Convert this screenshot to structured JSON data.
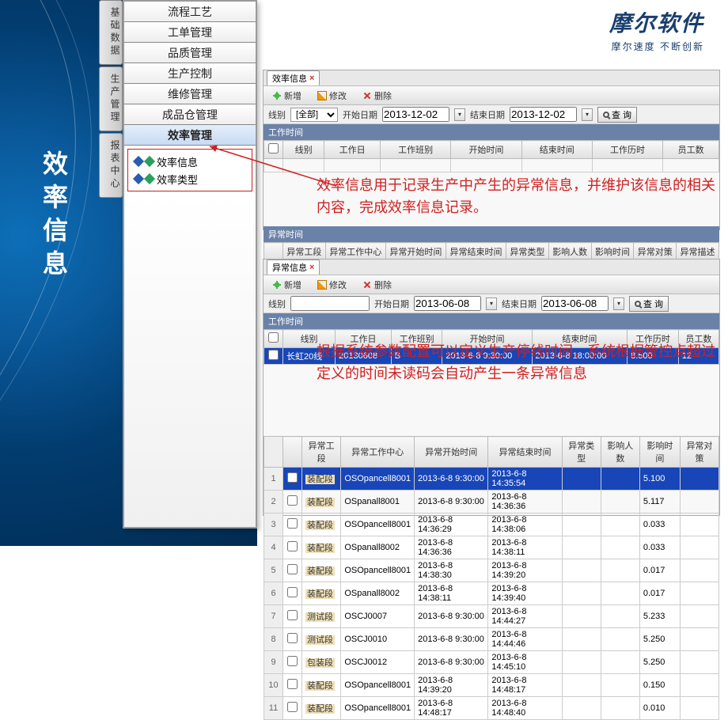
{
  "brand": {
    "logo": "摩尔软件",
    "slogan": "摩尔速度 不断创新"
  },
  "page_title": "效率信息",
  "nav_tabs": [
    "基础数据",
    "生产管理",
    "报表中心"
  ],
  "menu": {
    "items": [
      "流程工艺",
      "工单管理",
      "品质管理",
      "生产控制",
      "维修管理",
      "成品仓管理",
      "效率管理"
    ],
    "sub": [
      "效率信息",
      "效率类型"
    ]
  },
  "toolbar": {
    "add": "新增",
    "edit": "修改",
    "del": "删除"
  },
  "filter": {
    "line_lbl": "线别",
    "sel_all": "[全部]",
    "start_lbl": "开始日期",
    "end_lbl": "结束日期",
    "query": "查 询"
  },
  "panel1": {
    "tab": "效率信息",
    "date1": "2013-12-02",
    "date2": "2013-12-02",
    "group1": "工作时间",
    "cols1": [
      "",
      "线别",
      "工作日",
      "工作班别",
      "开始时间",
      "结束时间",
      "工作历时",
      "员工数"
    ],
    "group2": "异常时间",
    "cols2": [
      "",
      "异常工段",
      "异常工作中心",
      "异常开始时间",
      "异常结束时间",
      "异常类型",
      "影响人数",
      "影响时间",
      "异常对策",
      "异常描述"
    ]
  },
  "panel2": {
    "tab": "异常信息",
    "date1": "2013-06-08",
    "date2": "2013-06-08",
    "group1": "工作时间",
    "cols1": [
      "",
      "线别",
      "工作日",
      "工作班别",
      "开始时间",
      "结束时间",
      "工作历时",
      "员工数"
    ],
    "row1": [
      "",
      "长虹20线",
      "20130608",
      "B",
      "2013-6-8 9:30:00",
      "2013-6-8 18:00:00",
      "8.500",
      "12"
    ],
    "group2": "异常时间",
    "cols2": [
      "",
      "异常工段",
      "异常工作中心",
      "异常开始时间",
      "异常结束时间",
      "异常类型",
      "影响人数",
      "影响时间",
      "异常对策"
    ],
    "rows": [
      {
        "n": "1",
        "seg": "装配段",
        "wc": "OSOpancell8001",
        "st": "2013-6-8 9:30:00",
        "et": "2013-6-8 14:35:54",
        "tp": "",
        "pp": "",
        "im": "5.100",
        "cm": "",
        "hi": true
      },
      {
        "n": "2",
        "seg": "装配段",
        "wc": "OSpanall8001",
        "st": "2013-6-8 9:30:00",
        "et": "2013-6-8 14:36:36",
        "tp": "",
        "pp": "",
        "im": "5.117",
        "cm": ""
      },
      {
        "n": "3",
        "seg": "装配段",
        "wc": "OSOpancell8001",
        "st": "2013-6-8 14:36:29",
        "et": "2013-6-8 14:38:06",
        "tp": "",
        "pp": "",
        "im": "0.033",
        "cm": ""
      },
      {
        "n": "4",
        "seg": "装配段",
        "wc": "OSpanall8002",
        "st": "2013-6-8 14:36:36",
        "et": "2013-6-8 14:38:11",
        "tp": "",
        "pp": "",
        "im": "0.033",
        "cm": ""
      },
      {
        "n": "5",
        "seg": "装配段",
        "wc": "OSOpancell8001",
        "st": "2013-6-8 14:38:30",
        "et": "2013-6-8 14:39:20",
        "tp": "",
        "pp": "",
        "im": "0.017",
        "cm": ""
      },
      {
        "n": "6",
        "seg": "装配段",
        "wc": "OSpanall8002",
        "st": "2013-6-8 14:38:11",
        "et": "2013-6-8 14:39:40",
        "tp": "",
        "pp": "",
        "im": "0.017",
        "cm": ""
      },
      {
        "n": "7",
        "seg": "测试段",
        "wc": "OSCJ0007",
        "st": "2013-6-8 9:30:00",
        "et": "2013-6-8 14:44:27",
        "tp": "",
        "pp": "",
        "im": "5.233",
        "cm": ""
      },
      {
        "n": "8",
        "seg": "测试段",
        "wc": "OSCJ0010",
        "st": "2013-6-8 9:30:00",
        "et": "2013-6-8 14:44:46",
        "tp": "",
        "pp": "",
        "im": "5.250",
        "cm": ""
      },
      {
        "n": "9",
        "seg": "包装段",
        "wc": "OSCJ0012",
        "st": "2013-6-8 9:30:00",
        "et": "2013-6-8 14:45:10",
        "tp": "",
        "pp": "",
        "im": "5.250",
        "cm": ""
      },
      {
        "n": "10",
        "seg": "装配段",
        "wc": "OSOpancell8001",
        "st": "2013-6-8 14:39:20",
        "et": "2013-6-8 14:48:17",
        "tp": "",
        "pp": "",
        "im": "0.150",
        "cm": ""
      },
      {
        "n": "11",
        "seg": "装配段",
        "wc": "OSOpancell8001",
        "st": "2013-6-8 14:48:17",
        "et": "2013-6-8 14:48:40",
        "tp": "",
        "pp": "",
        "im": "0.010",
        "cm": ""
      }
    ]
  },
  "annot1": "效率信息用于记录生产中产生的异常信息，并维护该信息的相关内容，完成效率信息记录。",
  "annot2": "根据系统参数配置可以定义生产停线时间，系统根据管控点超过定义的时间未读码会自动产生一条异常信息"
}
